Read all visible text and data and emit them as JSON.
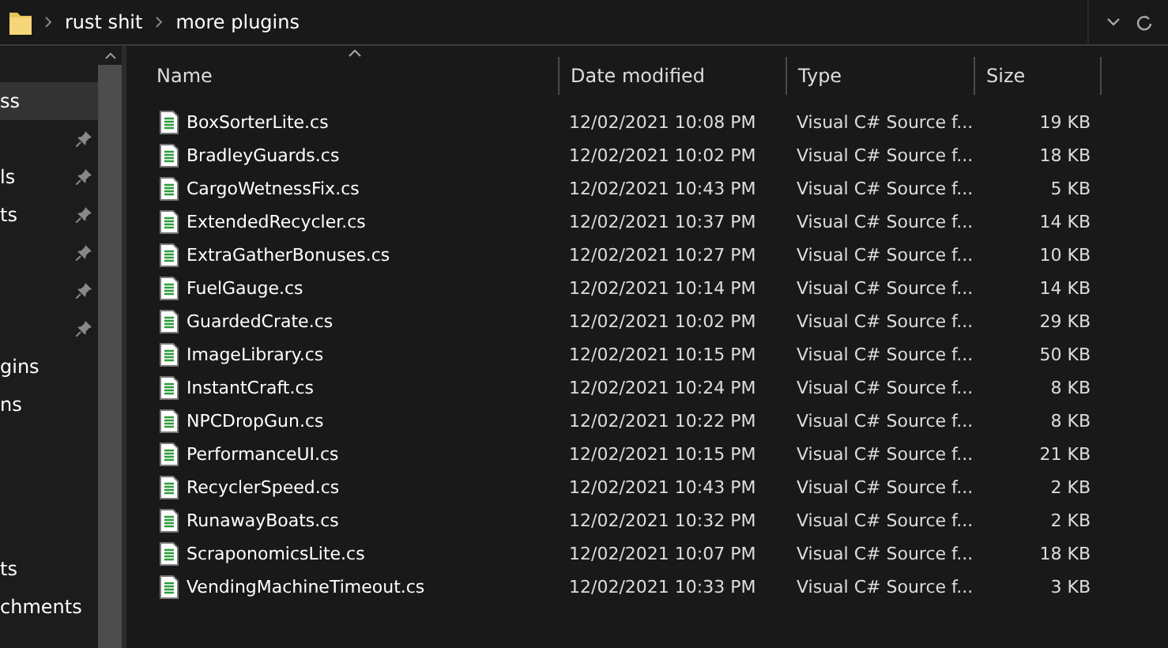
{
  "breadcrumb": [
    "rust shit",
    "more plugins"
  ],
  "sidebar": {
    "items": [
      {
        "label": "ss",
        "pinned": false,
        "selected": true
      },
      {
        "pinned": true,
        "selected": false
      },
      {
        "label": "ls",
        "pinned": true,
        "selected": false
      },
      {
        "label": "ts",
        "pinned": true,
        "selected": false
      },
      {
        "pinned": true,
        "selected": false
      },
      {
        "pinned": true,
        "selected": false
      },
      {
        "pinned": true,
        "selected": false
      },
      {
        "label": "gins",
        "pinned": false,
        "selected": false
      },
      {
        "label": "ns",
        "pinned": false,
        "selected": false
      },
      {
        "label": "ts",
        "pinned": false,
        "selected": false
      },
      {
        "label": "chments",
        "pinned": false,
        "selected": false
      }
    ]
  },
  "table": {
    "columns": [
      "Name",
      "Date modified",
      "Type",
      "Size"
    ],
    "rows": [
      [
        "BoxSorterLite.cs",
        "12/02/2021 10:08 PM",
        "Visual C# Source f...",
        "19 KB"
      ],
      [
        "BradleyGuards.cs",
        "12/02/2021 10:02 PM",
        "Visual C# Source f...",
        "18 KB"
      ],
      [
        "CargoWetnessFix.cs",
        "12/02/2021 10:43 PM",
        "Visual C# Source f...",
        "5 KB"
      ],
      [
        "ExtendedRecycler.cs",
        "12/02/2021 10:37 PM",
        "Visual C# Source f...",
        "14 KB"
      ],
      [
        "ExtraGatherBonuses.cs",
        "12/02/2021 10:27 PM",
        "Visual C# Source f...",
        "10 KB"
      ],
      [
        "FuelGauge.cs",
        "12/02/2021 10:14 PM",
        "Visual C# Source f...",
        "14 KB"
      ],
      [
        "GuardedCrate.cs",
        "12/02/2021 10:02 PM",
        "Visual C# Source f...",
        "29 KB"
      ],
      [
        "ImageLibrary.cs",
        "12/02/2021 10:15 PM",
        "Visual C# Source f...",
        "50 KB"
      ],
      [
        "InstantCraft.cs",
        "12/02/2021 10:24 PM",
        "Visual C# Source f...",
        "8 KB"
      ],
      [
        "NPCDropGun.cs",
        "12/02/2021 10:22 PM",
        "Visual C# Source f...",
        "8 KB"
      ],
      [
        "PerformanceUI.cs",
        "12/02/2021 10:15 PM",
        "Visual C# Source f...",
        "21 KB"
      ],
      [
        "RecyclerSpeed.cs",
        "12/02/2021 10:43 PM",
        "Visual C# Source f...",
        "2 KB"
      ],
      [
        "RunawayBoats.cs",
        "12/02/2021 10:32 PM",
        "Visual C# Source f...",
        "2 KB"
      ],
      [
        "ScraponomicsLite.cs",
        "12/02/2021 10:07 PM",
        "Visual C# Source f...",
        "18 KB"
      ],
      [
        "VendingMachineTimeout.cs",
        "12/02/2021 10:33 PM",
        "Visual C# Source f...",
        "3 KB"
      ]
    ]
  }
}
